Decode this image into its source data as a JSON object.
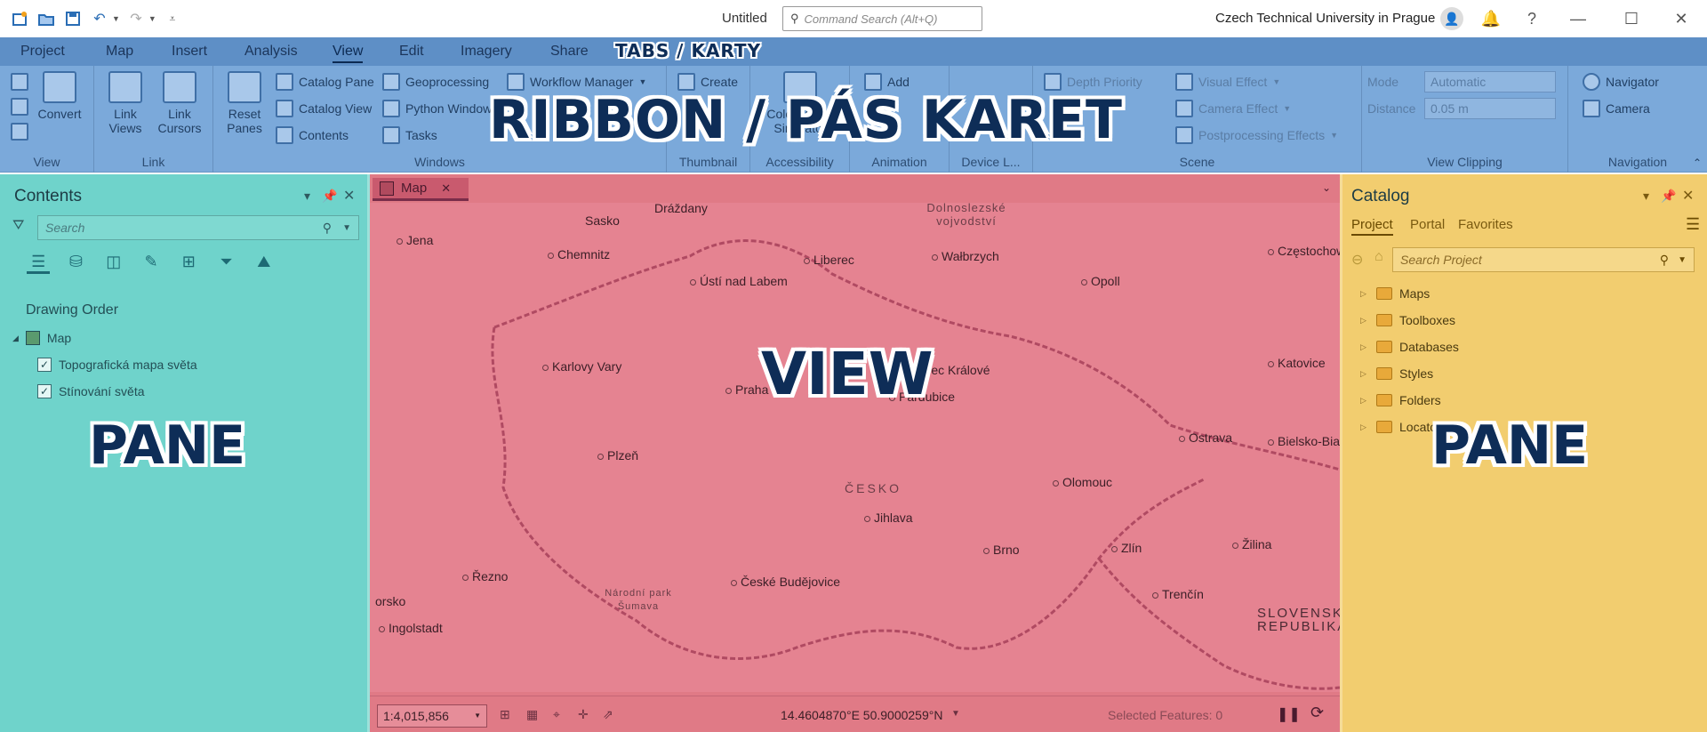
{
  "titlebar": {
    "doc_title": "Untitled",
    "command_search_placeholder": "Command Search (Alt+Q)",
    "organization": "Czech Technical University in Prague"
  },
  "tabs": [
    "Project",
    "Map",
    "Insert",
    "Analysis",
    "View",
    "Edit",
    "Imagery",
    "Share"
  ],
  "active_tab": "View",
  "overlay": {
    "tabs_label": "TABS / KARTY",
    "ribbon_label": "RIBBON / PÁS KARET",
    "left_pane_label": "PANE",
    "view_label": "VIEW",
    "right_pane_label": "PANE"
  },
  "ribbon": {
    "view_group": {
      "convert": "Convert",
      "label": "View"
    },
    "link_group": {
      "link_views": "Link Views",
      "link_cursors": "Link Cursors",
      "label": "Link"
    },
    "windows_group": {
      "reset_panes": "Reset Panes",
      "catalog_pane": "Catalog Pane",
      "catalog_view": "Catalog View",
      "contents": "Contents",
      "geoprocessing": "Geoprocessing",
      "python_window": "Python Window",
      "tasks": "Tasks",
      "workflow_manager": "Workflow Manager",
      "label": "Windows"
    },
    "thumbnail_group": {
      "create": "Create",
      "label": "Thumbnail"
    },
    "accessibility_group": {
      "color_simulator": "Color Vision Simulator",
      "label": "Accessibility"
    },
    "animation_group": {
      "add": "Add",
      "label": "Animation"
    },
    "device_group": {
      "label": "Device L..."
    },
    "scene_group": {
      "depth_priority": "Depth Priority",
      "visual_effect": "Visual Effect",
      "camera_effect": "Camera Effect",
      "postprocessing": "Postprocessing Effects",
      "label": "Scene"
    },
    "clipping_group": {
      "mode": "Mode",
      "mode_value": "Automatic",
      "distance": "Distance",
      "distance_value": "0.05  m",
      "label": "View Clipping"
    },
    "navigation_group": {
      "navigator": "Navigator",
      "camera": "Camera",
      "label": "Navigation"
    }
  },
  "contents_pane": {
    "title": "Contents",
    "search_placeholder": "Search",
    "section": "Drawing Order",
    "map_item": "Map",
    "layers": [
      {
        "name": "Topografická mapa světa",
        "checked": true
      },
      {
        "name": "Stínování světa",
        "checked": true
      }
    ]
  },
  "view": {
    "tab": "Map",
    "scale": "1:4,015,856",
    "coordinates": "14.4604870°E 50.9000259°N",
    "selected_features": "Selected Features: 0",
    "cities": [
      "Dráždany",
      "Sasko",
      "Jena",
      "Chemnitz",
      "Liberec",
      "Ústí nad Labem",
      "Wałbrzych",
      "Opoll",
      "Częstochowa",
      "Karlovy Vary",
      "Hradec Králové",
      "Praha",
      "Pardubice",
      "Katovice",
      "Plzeň",
      "Ostrava",
      "Bielsko-Biała",
      "Olomouc",
      "Jihlava",
      "Brno",
      "Zlín",
      "Žilina",
      "Řezno",
      "České Budějovice",
      "Trenčín",
      "Ingolstadt",
      "orsko",
      "Národní park Šumava"
    ],
    "regions": [
      "Dolnoslezské vojvodství",
      "ČESKO",
      "SLOVENSKO REPUBLIKA"
    ]
  },
  "catalog_pane": {
    "title": "Catalog",
    "tabs": [
      "Project",
      "Portal",
      "Favorites"
    ],
    "search_placeholder": "Search Project",
    "items": [
      "Maps",
      "Toolboxes",
      "Databases",
      "Styles",
      "Folders",
      "Locators"
    ]
  },
  "colors": {
    "ribbon": "#7ba9da",
    "left_pane": "#6fd3cb",
    "view": "#e07a86",
    "right_pane": "#f2cd6f",
    "label_text": "#0e2d57"
  }
}
